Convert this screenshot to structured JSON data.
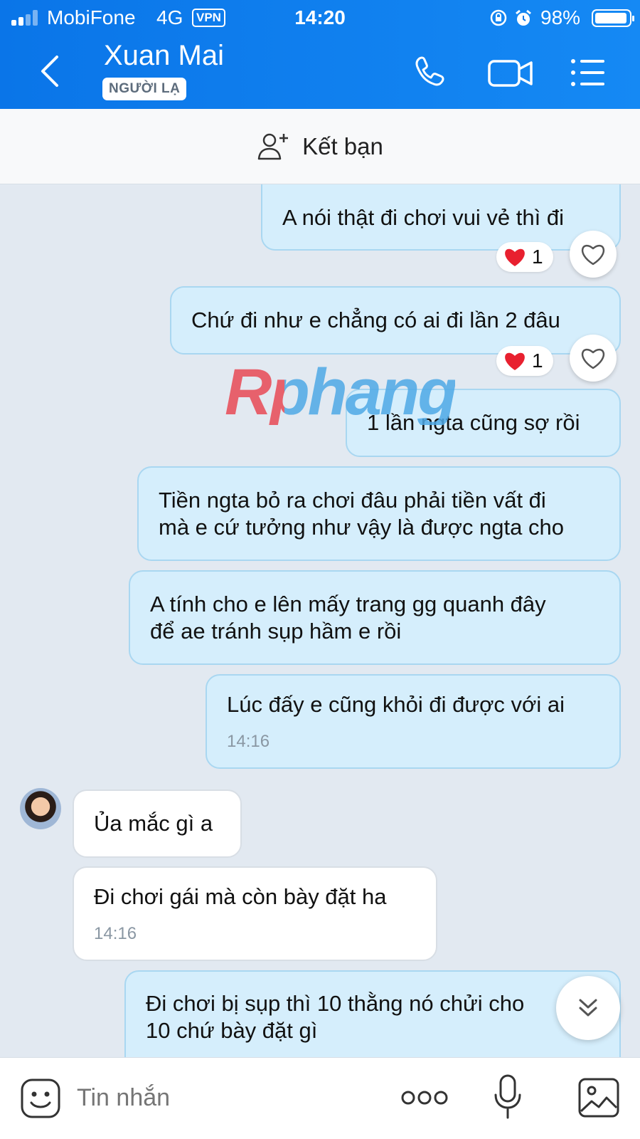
{
  "status_bar": {
    "carrier": "MobiFone",
    "network": "4G",
    "vpn": "VPN",
    "time": "14:20",
    "battery": "98%"
  },
  "header": {
    "contact_name": "Xuan Mai",
    "badge": "NGƯỜI LẠ",
    "icons": [
      "back-arrow-icon",
      "phone-icon",
      "video-call-icon",
      "menu-list-icon"
    ]
  },
  "friend_bar": {
    "label": "Kết bạn",
    "icon": "add-friend-icon"
  },
  "messages": [
    {
      "sender": "me",
      "lines": [
        "A nói thật đi chơi vui vẻ thì đi"
      ],
      "reaction": {
        "emoji": "heart",
        "count": "1"
      }
    },
    {
      "sender": "me",
      "lines": [
        "Chứ đi như e chẳng có ai đi lần 2 đâu"
      ],
      "reaction": {
        "emoji": "heart",
        "count": "1"
      }
    },
    {
      "sender": "me",
      "lines": [
        "1 lần ngta cũng sợ rồi"
      ]
    },
    {
      "sender": "me",
      "lines": [
        "Tiền ngta bỏ ra chơi đâu phải tiền vất đi",
        "mà e cứ tưởng như vậy là được ngta cho"
      ]
    },
    {
      "sender": "me",
      "lines": [
        "A tính cho e lên mấy trang gg quanh đây",
        "để ae tránh sụp hầm e rồi"
      ]
    },
    {
      "sender": "me",
      "lines": [
        "Lúc đấy e cũng khỏi đi được với ai"
      ],
      "time": "14:16"
    },
    {
      "sender": "them",
      "lines": [
        "Ủa mắc gì a"
      ]
    },
    {
      "sender": "them",
      "lines": [
        "Đi chơi gái mà còn bày đặt ha"
      ],
      "time": "14:16"
    },
    {
      "sender": "me",
      "lines": [
        "Đi chơi bị sụp thì 10 thằng nó chửi cho",
        "10 chứ bày đặt gì"
      ]
    }
  ],
  "watermark": "Rphang",
  "input_bar": {
    "placeholder": "Tin nhắn",
    "icons": [
      "sticker-icon",
      "more-options-icon",
      "microphone-icon",
      "image-icon"
    ]
  },
  "colors": {
    "header": "#0a75e8",
    "bubble_me": "#d5eefc",
    "bubble_them": "#ffffff",
    "chat_bg": "#e2e9f1",
    "reaction_heart": "#e8202f"
  }
}
